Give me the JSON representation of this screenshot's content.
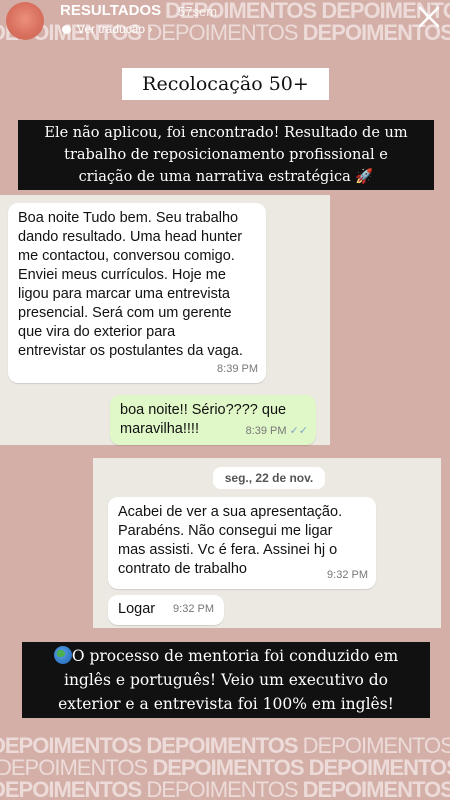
{
  "story": {
    "name": "RESULTADOS",
    "time": "57sem",
    "translate_label": "Ver tradução",
    "translate_chevron": "›"
  },
  "watermark": {
    "row1": [
      "DEPOIMENTOS",
      "DEPOIMENTOS",
      "DEPOIMENTOS"
    ],
    "row2": [
      "DEPOIMENTOS",
      "DEPOIMENTOS",
      "DEPOIMENTOS"
    ],
    "row3": [
      "DEPOIMENTOS",
      "DEPOIMENTOS",
      "DEPOIMENTOS"
    ],
    "row4": [
      "DEPOIMENTOS",
      "DEPOIMENTOS",
      "DEPOIMENTOS"
    ],
    "row5": [
      "DEPOIMENTOS",
      "DEPOIMENTOS",
      "DEPOIMENTOS"
    ]
  },
  "title": "Recolocação 50+",
  "intro": {
    "line1": "Ele não aplicou, foi encontrado! Resultado de um",
    "line2": "trabalho de reposicionamento profissional e",
    "line3": "criação de uma narrativa estratégica",
    "emoji": "🚀"
  },
  "chat1": {
    "incoming": {
      "lines": [
        "Boa noite Tudo bem. Seu trabalho",
        "dando resultado. Uma head hunter",
        "me contactou, conversou comigo.",
        "Enviei meus currículos. Hoje me",
        "ligou para marcar uma entrevista",
        "presencial. Será com um gerente",
        "que vira do exterior para",
        "entrevistar os postulantes da vaga."
      ],
      "time": "8:39 PM"
    },
    "outgoing": {
      "lines": [
        "boa noite!! Sério???? que",
        "maravilha!!!!"
      ],
      "time": "8:39 PM",
      "ticks": "✓✓"
    }
  },
  "chat2": {
    "date": "seg., 22 de nov.",
    "message": {
      "lines": [
        "Acabei de ver a sua apresentação.",
        "Parabéns. Não consegui me ligar",
        "mas assisti. Vc é fera. Assinei hj o",
        "contrato de trabalho"
      ],
      "time": "9:32 PM"
    },
    "message2": {
      "text": "Logar",
      "time": "9:32 PM"
    }
  },
  "outro": {
    "line1": "O processo de mentoria foi conduzido em",
    "line2": "inglês e português! Veio um executivo do",
    "line3": "exterior e a entrevista foi 100% em inglês!"
  }
}
